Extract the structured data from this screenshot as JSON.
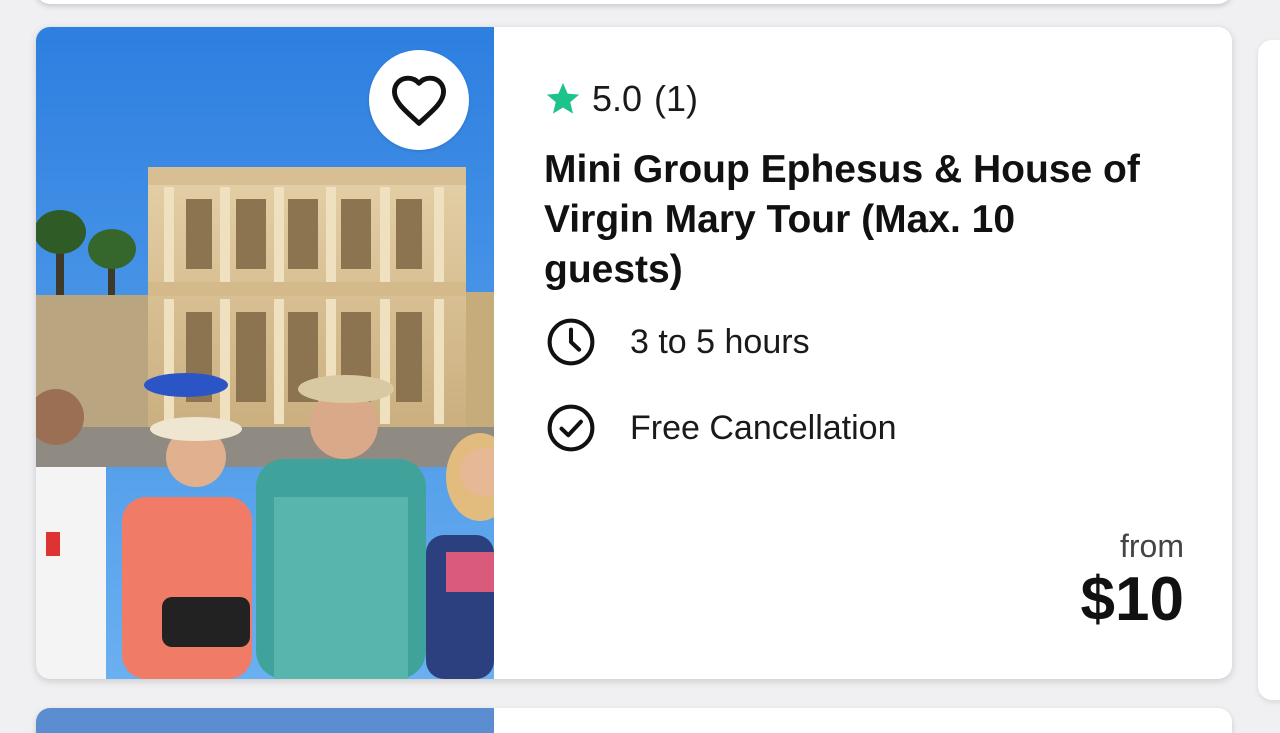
{
  "listing": {
    "rating": "5.0",
    "review_count": "(1)",
    "title": "Mini Group Ephesus & House of Virgin Mary Tour (Max. 10 guests)",
    "duration": "3 to 5 hours",
    "cancellation": "Free Cancellation",
    "price_prefix": "from",
    "price": "$10",
    "image_description": "ephesus-library-group-photo"
  },
  "icons": {
    "favorite": "heart-outline-icon",
    "rating": "star-icon",
    "duration": "clock-icon",
    "cancellation": "check-circle-icon"
  },
  "colors": {
    "star": "#1ec28b",
    "text": "#111111",
    "card": "#ffffff"
  }
}
